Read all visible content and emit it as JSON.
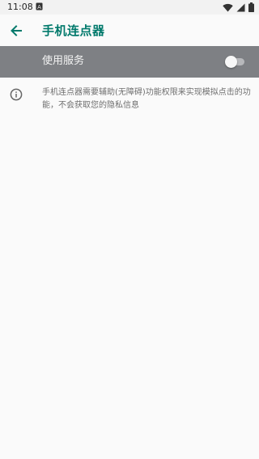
{
  "status_bar": {
    "time": "11:08",
    "notification_icon": "a-letter-icon",
    "wifi_icon": "wifi-icon",
    "signal_icon": "signal-icon",
    "battery_icon": "battery-icon"
  },
  "app_bar": {
    "title": "手机连点器",
    "back_icon": "back-arrow-icon",
    "title_color": "#00796b"
  },
  "master_switch": {
    "label": "使用服务",
    "checked": false,
    "background_color": "#7e8084"
  },
  "info": {
    "icon": "info-icon",
    "text": "手机连点器需要辅助(无障碍)功能权限来实现模拟点击的功能，不会获取您的隐私信息"
  }
}
